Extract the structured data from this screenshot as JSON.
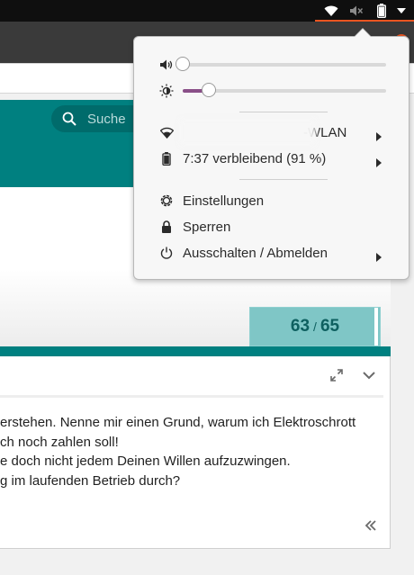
{
  "top_panel": {
    "icons": [
      "wifi-icon",
      "volume-muted-icon",
      "battery-icon",
      "menu-arrow-icon"
    ],
    "accent": "#e95420"
  },
  "search": {
    "placeholder": "Suche"
  },
  "counter": {
    "current": "63",
    "separator": "/",
    "total": "65"
  },
  "comment": {
    "lines": [
      "erstehen. Nenne mir einen Grund, warum ich Elektroschrott",
      "ch noch zahlen soll!",
      "e doch nicht jedem Deinen Willen aufzuzwingen.",
      "g im laufenden Betrieb durch?"
    ]
  },
  "system_menu": {
    "volume": {
      "icon": "speaker-icon",
      "level": 0.0
    },
    "brightness": {
      "icon": "brightness-icon",
      "level": 0.13,
      "fill_color": "#8a4f88"
    },
    "items": [
      {
        "icon": "wifi-icon",
        "label": "-WLAN",
        "has_submenu": true
      },
      {
        "icon": "battery-icon",
        "label": "7:37 verbleibend (91 %)",
        "has_submenu": true
      },
      {
        "icon": "settings-icon",
        "label": "Einstellungen",
        "has_submenu": false
      },
      {
        "icon": "lock-icon",
        "label": "Sperren",
        "has_submenu": false
      },
      {
        "icon": "power-icon",
        "label": "Ausschalten / Abmelden",
        "has_submenu": true
      }
    ]
  },
  "colors": {
    "teal": "#008080",
    "counter_bg": "#7fc6c6",
    "counter_text": "#0e6060",
    "panel_bg": "#0f0f0f"
  }
}
